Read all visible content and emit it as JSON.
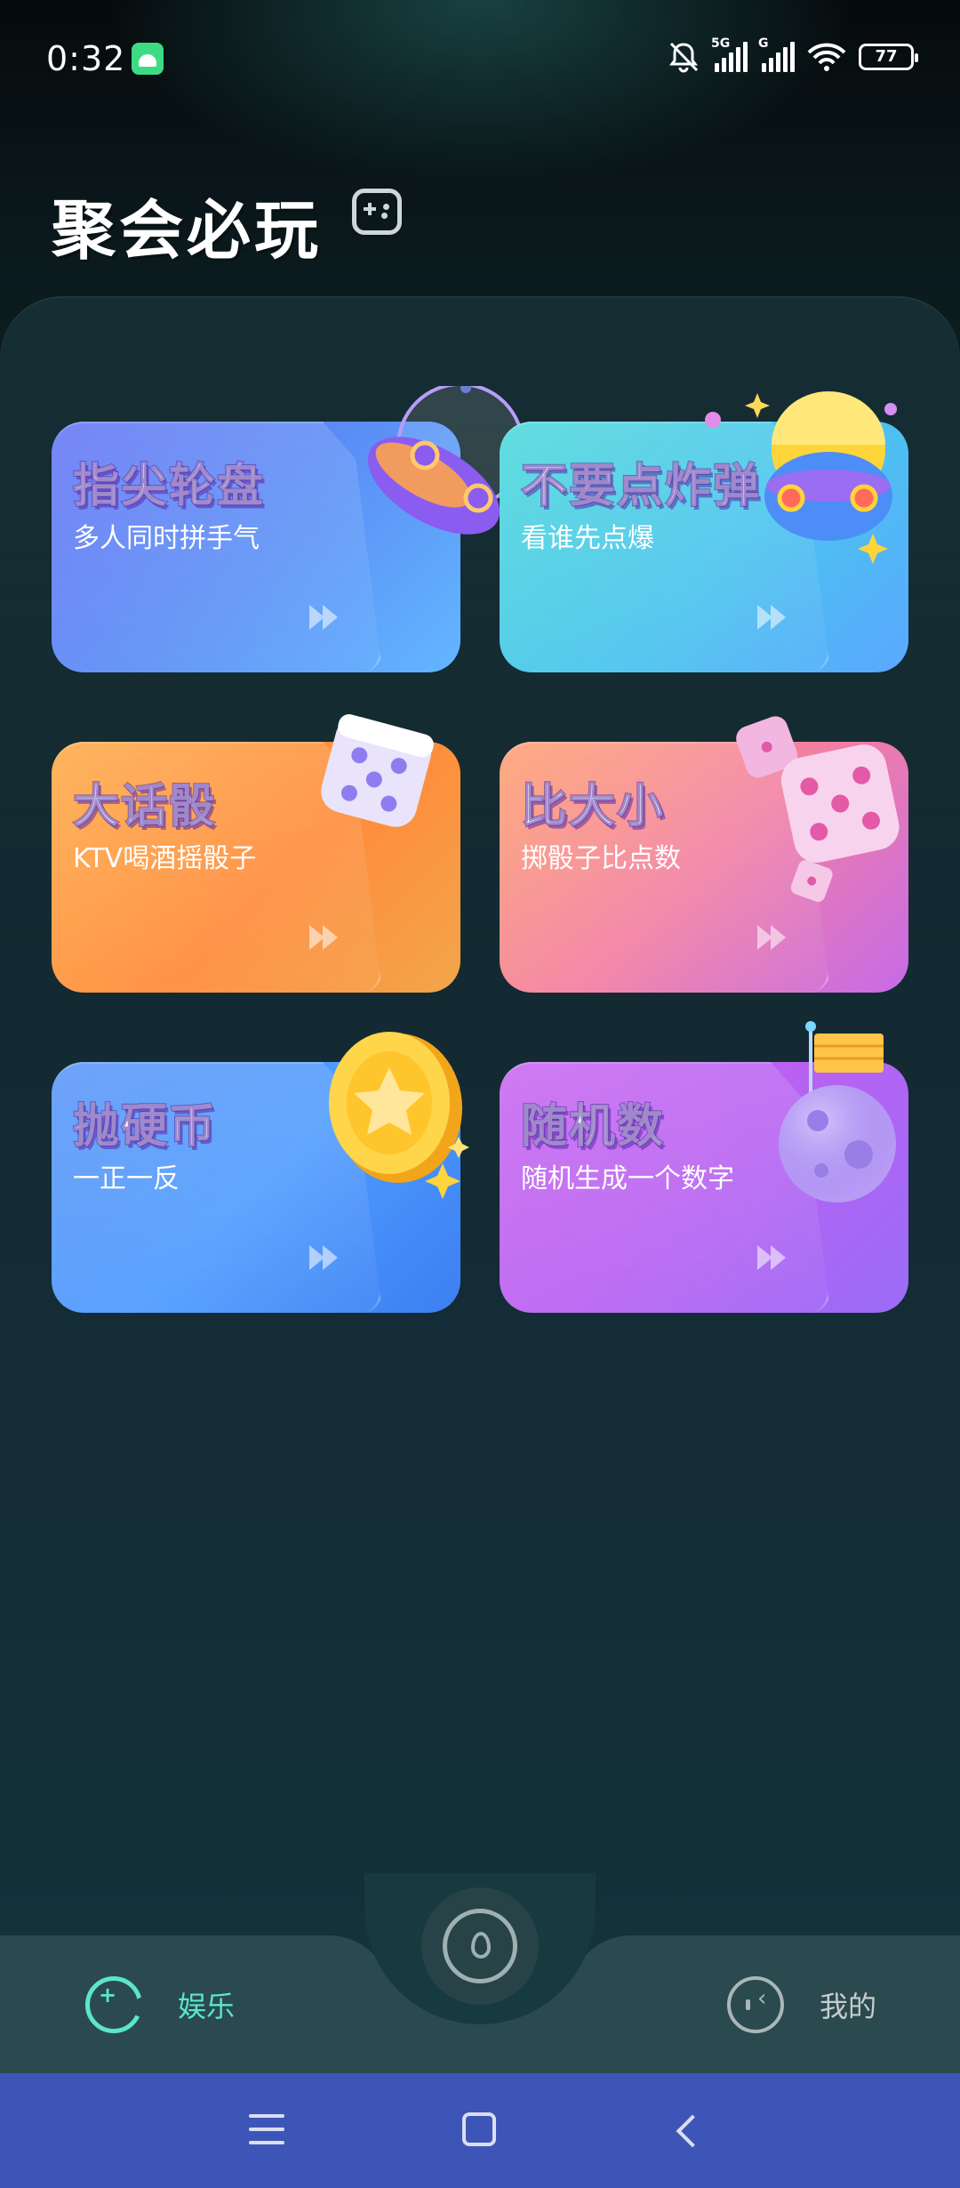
{
  "status_bar": {
    "time": "0:32",
    "network_1": "5G",
    "network_2": "G",
    "battery": "77",
    "icons": [
      "android-app-icon",
      "bell-muted-icon",
      "signal-icon",
      "signal-icon",
      "wifi-icon",
      "battery-icon"
    ]
  },
  "header": {
    "title": "聚会必玩",
    "icon": "gamepad-icon"
  },
  "games": [
    {
      "name": "指尖轮盘",
      "desc": "多人同时拼手气",
      "color": "#5b8ff6",
      "icon": "ufo-icon"
    },
    {
      "name": "不要点炸弹",
      "desc": "看谁先点爆",
      "color": "#40d6d8",
      "icon": "bomb-icon"
    },
    {
      "name": "大话骰",
      "desc": "KTV喝酒摇骰子",
      "color": "#ffa53c",
      "icon": "dice-icon"
    },
    {
      "name": "比大小",
      "desc": "掷骰子比点数",
      "color": "#f27fa2",
      "icon": "dice-icon"
    },
    {
      "name": "抛硬币",
      "desc": "一正一反",
      "color": "#4f8ff7",
      "icon": "coin-icon"
    },
    {
      "name": "随机数",
      "desc": "随机生成一个数字",
      "color": "#c55df0",
      "icon": "planet-flag-icon"
    }
  ],
  "bottom_nav": {
    "entertainment_label": "娱乐",
    "mine_label": "我的",
    "accent": "#5ce6c8",
    "center_icon": "drop-icon"
  },
  "system_nav": {
    "icons": [
      "menu-icon",
      "home-icon",
      "back-icon"
    ],
    "color": "#3e55b8"
  }
}
